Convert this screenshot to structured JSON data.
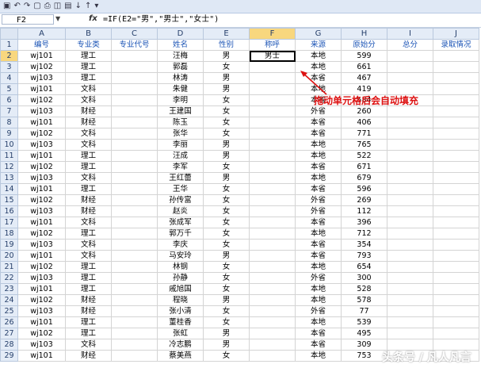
{
  "name_box": "F2",
  "fx_label": "fx",
  "formula": "=IF(E2=\"男\",\"男士\",\"女士\")",
  "qat_icons": [
    "save-icon",
    "undo-icon",
    "redo-icon",
    "new-icon",
    "print-icon",
    "preview-icon",
    "open-icon",
    "sort-asc-icon",
    "sort-desc-icon",
    "customize-icon"
  ],
  "columns": [
    "A",
    "B",
    "C",
    "D",
    "E",
    "F",
    "G",
    "H",
    "I",
    "J"
  ],
  "headers": [
    "编号",
    "专业类",
    "专业代号",
    "姓名",
    "性别",
    "称呼",
    "来源",
    "原始分",
    "总分",
    "录取情况"
  ],
  "rows": [
    {
      "n": "2",
      "a": "wj101",
      "b": "理工",
      "d": "汪梅",
      "e": "男",
      "f": "男士",
      "g": "本地",
      "h": "599"
    },
    {
      "n": "3",
      "a": "wj102",
      "b": "理工",
      "d": "郭磊",
      "e": "女",
      "f": "",
      "g": "本地",
      "h": "661"
    },
    {
      "n": "4",
      "a": "wj103",
      "b": "理工",
      "d": "林涛",
      "e": "男",
      "f": "",
      "g": "本省",
      "h": "467"
    },
    {
      "n": "5",
      "a": "wj101",
      "b": "文科",
      "d": "朱健",
      "e": "男",
      "f": "",
      "g": "本地",
      "h": "419"
    },
    {
      "n": "6",
      "a": "wj102",
      "b": "文科",
      "d": "李明",
      "e": "女",
      "f": "",
      "g": "本省",
      "h": "584"
    },
    {
      "n": "7",
      "a": "wj103",
      "b": "财经",
      "d": "王建国",
      "e": "女",
      "f": "",
      "g": "外省",
      "h": "260"
    },
    {
      "n": "8",
      "a": "wj101",
      "b": "财经",
      "d": "陈玉",
      "e": "女",
      "f": "",
      "g": "本省",
      "h": "406"
    },
    {
      "n": "9",
      "a": "wj102",
      "b": "文科",
      "d": "张华",
      "e": "女",
      "f": "",
      "g": "本省",
      "h": "771"
    },
    {
      "n": "10",
      "a": "wj103",
      "b": "文科",
      "d": "李丽",
      "e": "男",
      "f": "",
      "g": "本地",
      "h": "765"
    },
    {
      "n": "11",
      "a": "wj101",
      "b": "理工",
      "d": "汪成",
      "e": "男",
      "f": "",
      "g": "本地",
      "h": "522"
    },
    {
      "n": "12",
      "a": "wj102",
      "b": "理工",
      "d": "李军",
      "e": "女",
      "f": "",
      "g": "本省",
      "h": "671"
    },
    {
      "n": "13",
      "a": "wj103",
      "b": "文科",
      "d": "王红蕾",
      "e": "男",
      "f": "",
      "g": "本地",
      "h": "679"
    },
    {
      "n": "14",
      "a": "wj101",
      "b": "理工",
      "d": "王华",
      "e": "女",
      "f": "",
      "g": "本省",
      "h": "596"
    },
    {
      "n": "15",
      "a": "wj102",
      "b": "财经",
      "d": "孙传富",
      "e": "女",
      "f": "",
      "g": "外省",
      "h": "269"
    },
    {
      "n": "16",
      "a": "wj103",
      "b": "财经",
      "d": "赵炎",
      "e": "女",
      "f": "",
      "g": "外省",
      "h": "112"
    },
    {
      "n": "17",
      "a": "wj101",
      "b": "文科",
      "d": "张成军",
      "e": "女",
      "f": "",
      "g": "本省",
      "h": "396"
    },
    {
      "n": "18",
      "a": "wj102",
      "b": "理工",
      "d": "郭万千",
      "e": "女",
      "f": "",
      "g": "本地",
      "h": "712"
    },
    {
      "n": "19",
      "a": "wj103",
      "b": "文科",
      "d": "李庆",
      "e": "女",
      "f": "",
      "g": "本省",
      "h": "354"
    },
    {
      "n": "20",
      "a": "wj101",
      "b": "文科",
      "d": "马安玲",
      "e": "男",
      "f": "",
      "g": "本省",
      "h": "793"
    },
    {
      "n": "21",
      "a": "wj102",
      "b": "理工",
      "d": "林钢",
      "e": "女",
      "f": "",
      "g": "本地",
      "h": "654"
    },
    {
      "n": "22",
      "a": "wj103",
      "b": "理工",
      "d": "孙静",
      "e": "女",
      "f": "",
      "g": "外省",
      "h": "300"
    },
    {
      "n": "23",
      "a": "wj101",
      "b": "理工",
      "d": "戚旭国",
      "e": "女",
      "f": "",
      "g": "本地",
      "h": "528"
    },
    {
      "n": "24",
      "a": "wj102",
      "b": "财经",
      "d": "程晓",
      "e": "男",
      "f": "",
      "g": "本地",
      "h": "578"
    },
    {
      "n": "25",
      "a": "wj103",
      "b": "财经",
      "d": "张小清",
      "e": "女",
      "f": "",
      "g": "外省",
      "h": "77"
    },
    {
      "n": "26",
      "a": "wj101",
      "b": "理工",
      "d": "董桂香",
      "e": "女",
      "f": "",
      "g": "本地",
      "h": "539"
    },
    {
      "n": "27",
      "a": "wj102",
      "b": "理工",
      "d": "张虹",
      "e": "男",
      "f": "",
      "g": "本省",
      "h": "495"
    },
    {
      "n": "28",
      "a": "wj103",
      "b": "文科",
      "d": "冷志鹏",
      "e": "男",
      "f": "",
      "g": "本省",
      "h": "309"
    },
    {
      "n": "29",
      "a": "wj101",
      "b": "财经",
      "d": "蔡美燕",
      "e": "女",
      "f": "",
      "g": "本地",
      "h": "753"
    }
  ],
  "annotation": "拖动单元格后会自动填充",
  "watermark": "头条号 / 凡人凡言"
}
